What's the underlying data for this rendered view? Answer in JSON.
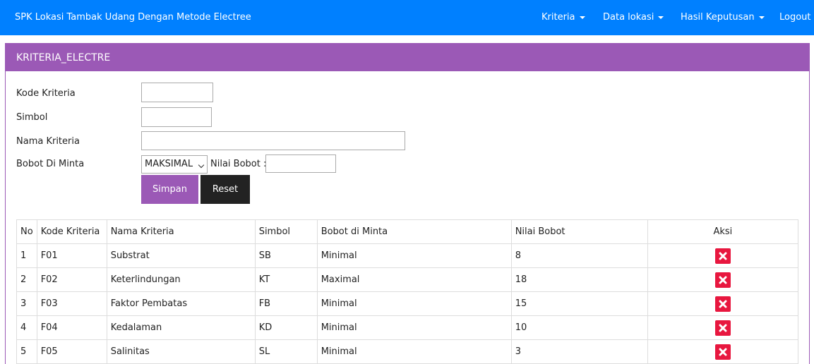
{
  "navbar": {
    "brand": "SPK Lokasi Tambak Udang Dengan Metode Electree",
    "items": [
      {
        "label": "Kriteria",
        "dropdown": true
      },
      {
        "label": "Data lokasi",
        "dropdown": true
      },
      {
        "label": "Hasil Keputusan",
        "dropdown": true
      },
      {
        "label": "Logout",
        "dropdown": false
      }
    ]
  },
  "panel": {
    "title": "KRITERIA_ELECTRE"
  },
  "form": {
    "kode_label": "Kode Kriteria",
    "kode_value": "",
    "simbol_label": "Simbol",
    "simbol_value": "",
    "nama_label": "Nama Kriteria",
    "nama_value": "",
    "bobot_label": "Bobot Di Minta",
    "bobot_selected": "MAKSIMAL",
    "nilai_label": "Nilai Bobot :",
    "nilai_value": "",
    "simpan_label": "Simpan",
    "reset_label": "Reset"
  },
  "table": {
    "headers": [
      "No",
      "Kode Kriteria",
      "Nama Kriteria",
      "Simbol",
      "Bobot di Minta",
      "Nilai Bobot",
      "Aksi"
    ],
    "rows": [
      [
        "1",
        "F01",
        "Substrat",
        "SB",
        "Minimal",
        "8"
      ],
      [
        "2",
        "F02",
        "Keterlindungan",
        "KT",
        "Maximal",
        "18"
      ],
      [
        "3",
        "F03",
        "Faktor Pembatas",
        "FB",
        "Minimal",
        "15"
      ],
      [
        "4",
        "F04",
        "Kedalaman",
        "KD",
        "Minimal",
        "10"
      ],
      [
        "5",
        "F05",
        "Salinitas",
        "SL",
        "Minimal",
        "3"
      ]
    ],
    "action_icon": "delete-icon",
    "action_color": "#e8173f"
  },
  "colors": {
    "navbar": "#0080ff",
    "panel_heading": "#9b59b6",
    "simpan_button": "#9b59b6",
    "reset_button": "#222222"
  }
}
